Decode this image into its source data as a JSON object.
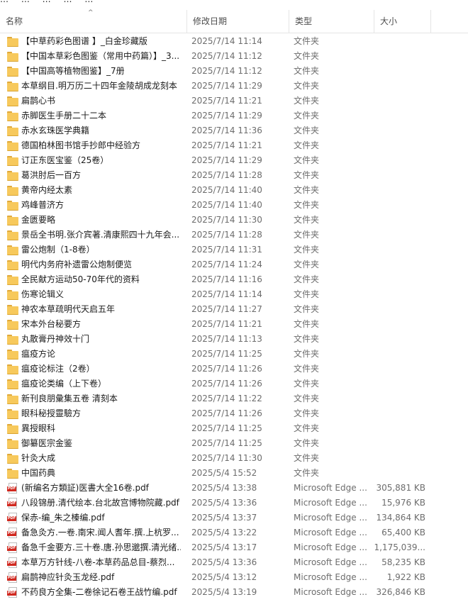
{
  "breadcrumb": [
    "…",
    "…",
    "…",
    "…",
    "…"
  ],
  "columns": {
    "name": "名称",
    "date": "修改日期",
    "type": "类型",
    "size": "大小"
  },
  "rows": [
    {
      "kind": "folder",
      "name": "【中草药彩色图谱 】_白金珍藏版",
      "date": "2025/7/14 11:14",
      "type": "文件夹",
      "size": ""
    },
    {
      "kind": "folder",
      "name": "【中国本草彩色图鉴（常用中药篇）】_3...",
      "date": "2025/7/14 11:12",
      "type": "文件夹",
      "size": ""
    },
    {
      "kind": "folder",
      "name": "【中国高等植物图鉴】_7册",
      "date": "2025/7/14 11:12",
      "type": "文件夹",
      "size": ""
    },
    {
      "kind": "folder",
      "name": "本草纲目.明万历二十四年金陵胡成龙刻本",
      "date": "2025/7/14 11:29",
      "type": "文件夹",
      "size": ""
    },
    {
      "kind": "folder",
      "name": "扁鹊心书",
      "date": "2025/7/14 11:21",
      "type": "文件夹",
      "size": ""
    },
    {
      "kind": "folder",
      "name": "赤脚医生手册二十二本",
      "date": "2025/7/14 11:29",
      "type": "文件夹",
      "size": ""
    },
    {
      "kind": "folder",
      "name": "赤水玄珠医学典籍",
      "date": "2025/7/14 11:36",
      "type": "文件夹",
      "size": ""
    },
    {
      "kind": "folder",
      "name": "德国柏林图书馆手抄郎中经验方",
      "date": "2025/7/14 11:21",
      "type": "文件夹",
      "size": ""
    },
    {
      "kind": "folder",
      "name": "订正东医宝鉴（25卷）",
      "date": "2025/7/14 11:29",
      "type": "文件夹",
      "size": ""
    },
    {
      "kind": "folder",
      "name": "葛洪肘后一百方",
      "date": "2025/7/14 11:28",
      "type": "文件夹",
      "size": ""
    },
    {
      "kind": "folder",
      "name": "黄帝内经太素",
      "date": "2025/7/14 11:40",
      "type": "文件夹",
      "size": ""
    },
    {
      "kind": "folder",
      "name": "鸡峰普济方",
      "date": "2025/7/14 11:40",
      "type": "文件夹",
      "size": ""
    },
    {
      "kind": "folder",
      "name": "金匮要略",
      "date": "2025/7/14 11:30",
      "type": "文件夹",
      "size": ""
    },
    {
      "kind": "folder",
      "name": "景岳全书明.张介宾著.清康熙四十九年会...",
      "date": "2025/7/14 11:28",
      "type": "文件夹",
      "size": ""
    },
    {
      "kind": "folder",
      "name": "雷公炮制（1-8卷）",
      "date": "2025/7/14 11:31",
      "type": "文件夹",
      "size": ""
    },
    {
      "kind": "folder",
      "name": "明代内务府补遗雷公炮制便览",
      "date": "2025/7/14 11:24",
      "type": "文件夹",
      "size": ""
    },
    {
      "kind": "folder",
      "name": "全民献方运动50-70年代的资料",
      "date": "2025/7/14 11:16",
      "type": "文件夹",
      "size": ""
    },
    {
      "kind": "folder",
      "name": "伤寒论辑义",
      "date": "2025/7/14 11:14",
      "type": "文件夹",
      "size": ""
    },
    {
      "kind": "folder",
      "name": "神农本草疏明代天启五年",
      "date": "2025/7/14 11:27",
      "type": "文件夹",
      "size": ""
    },
    {
      "kind": "folder",
      "name": "宋本外台秘要方",
      "date": "2025/7/14 11:21",
      "type": "文件夹",
      "size": ""
    },
    {
      "kind": "folder",
      "name": "丸散膏丹神效十门",
      "date": "2025/7/14 11:13",
      "type": "文件夹",
      "size": ""
    },
    {
      "kind": "folder",
      "name": "瘟疫方论",
      "date": "2025/7/14 11:25",
      "type": "文件夹",
      "size": ""
    },
    {
      "kind": "folder",
      "name": "瘟疫论标注（2卷）",
      "date": "2025/7/14 11:26",
      "type": "文件夹",
      "size": ""
    },
    {
      "kind": "folder",
      "name": "瘟疫论类编（上下卷）",
      "date": "2025/7/14 11:26",
      "type": "文件夹",
      "size": ""
    },
    {
      "kind": "folder",
      "name": "新刊良朋彙集五卷 清刻本",
      "date": "2025/7/14 11:22",
      "type": "文件夹",
      "size": ""
    },
    {
      "kind": "folder",
      "name": "眼科秘授靈驗方",
      "date": "2025/7/14 11:26",
      "type": "文件夹",
      "size": ""
    },
    {
      "kind": "folder",
      "name": "異授眼科",
      "date": "2025/7/14 11:25",
      "type": "文件夹",
      "size": ""
    },
    {
      "kind": "folder",
      "name": "御纂医宗金鉴",
      "date": "2025/7/14 11:25",
      "type": "文件夹",
      "size": ""
    },
    {
      "kind": "folder",
      "name": "针灸大成",
      "date": "2025/7/14 11:30",
      "type": "文件夹",
      "size": ""
    },
    {
      "kind": "folder",
      "name": "中国药典",
      "date": "2025/5/4 15:52",
      "type": "文件夹",
      "size": ""
    },
    {
      "kind": "pdf",
      "name": "(新编名方類証)医書大全16卷.pdf",
      "date": "2025/5/4 13:38",
      "type": "Microsoft Edge ...",
      "size": "305,881 KB"
    },
    {
      "kind": "pdf",
      "name": "八段锦册.清代绘本.台北故宫博物院藏.pdf",
      "date": "2025/5/4 13:36",
      "type": "Microsoft Edge ...",
      "size": "15,976 KB"
    },
    {
      "kind": "pdf",
      "name": "保赤-编_朱之榛编.pdf",
      "date": "2025/5/4 13:37",
      "type": "Microsoft Edge ...",
      "size": "134,864 KB"
    },
    {
      "kind": "pdf",
      "name": "备急灸方.一卷.南宋.闻人耆年.撰.上杭罗...",
      "date": "2025/5/4 13:22",
      "type": "Microsoft Edge ...",
      "size": "65,400 KB"
    },
    {
      "kind": "pdf",
      "name": "备急千金要方.三十卷.唐.孙思邈撰.清光绪...",
      "date": "2025/5/4 13:17",
      "type": "Microsoft Edge ...",
      "size": "1,175,039..."
    },
    {
      "kind": "pdf",
      "name": "本草万方针线-八卷-本草药品总目-蔡烈...",
      "date": "2025/5/4 13:36",
      "type": "Microsoft Edge ...",
      "size": "58,235 KB"
    },
    {
      "kind": "pdf",
      "name": "扁鹊神应针灸玉龙经.pdf",
      "date": "2025/5/4 13:12",
      "type": "Microsoft Edge ...",
      "size": "1,922 KB"
    },
    {
      "kind": "pdf",
      "name": "不药良方全集-二卷徐记石卷王战竹编.pdf",
      "date": "2025/5/4 13:19",
      "type": "Microsoft Edge ...",
      "size": "326,846 KB"
    }
  ]
}
